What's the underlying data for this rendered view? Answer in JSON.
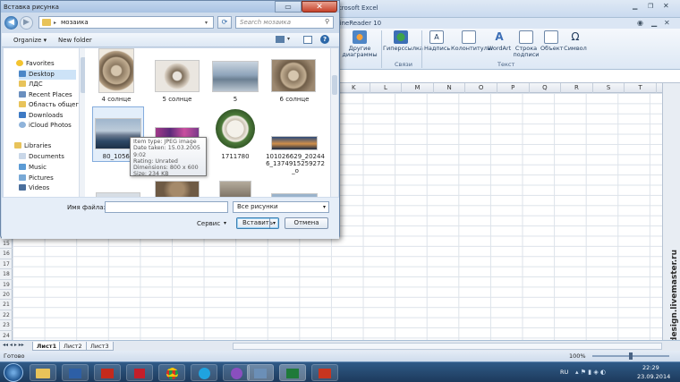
{
  "excel": {
    "title": "icrosoft Excel",
    "addin_tab": "FineReader 10",
    "ribbon": {
      "other_diagrams": "Другие\nдиаграммы",
      "hyperlink": "Гиперссылка",
      "text_box": "Надпись",
      "header_footer": "Колонтитулы",
      "wordart": "WordArt",
      "signature_line": "Строка\nподписи",
      "object": "Объект",
      "symbol": "Символ",
      "group_links": "Связи",
      "group_text": "Текст"
    },
    "columns": [
      "K",
      "L",
      "M",
      "N",
      "O",
      "P",
      "Q",
      "R",
      "S",
      "T"
    ],
    "rows": [
      "15",
      "16",
      "17",
      "18",
      "19",
      "20",
      "21",
      "22",
      "23",
      "24",
      "25"
    ],
    "sheets": [
      "Лист1",
      "Лист2",
      "Лист3"
    ],
    "status": "Готово",
    "zoom": "100%",
    "watermark": "design.livemaster.ru"
  },
  "dialog": {
    "title": "Вставка рисунка",
    "path": "мозаика",
    "search_placeholder": "Search мозаика",
    "organize": "Organize ▾",
    "new_folder": "New folder",
    "nav": {
      "favorites": "Favorites",
      "items": [
        "Desktop",
        "ЛДС",
        "Recent Places",
        "Область общего",
        "Downloads",
        "iCloud Photos"
      ],
      "libraries": "Libraries",
      "lib_items": [
        "Documents",
        "Music",
        "Pictures",
        "Videos"
      ]
    },
    "files": [
      {
        "name": "4 солнце"
      },
      {
        "name": "5 солнце"
      },
      {
        "name": "5"
      },
      {
        "name": "6 солнце"
      },
      {
        "name": "80_10561"
      },
      {
        "name": ""
      },
      {
        "name": "1711780"
      },
      {
        "name": "101026629_20244\n6_1374915259272\n_o"
      }
    ],
    "tooltip": {
      "type": "Item type: JPEG image",
      "date": "Date taken: 15.03.2005 9:02",
      "rating": "Rating: Unrated",
      "dimensions": "Dimensions: 800 x 600",
      "size": "Size: 234 KB"
    },
    "filename_label": "Имя файла:",
    "filename_value": "",
    "filter": "Все рисунки",
    "service": "Сервис",
    "insert": "Вставить",
    "cancel": "Отмена"
  },
  "taskbar": {
    "lang": "RU",
    "time": "22:29",
    "date": "23.09.2014"
  }
}
